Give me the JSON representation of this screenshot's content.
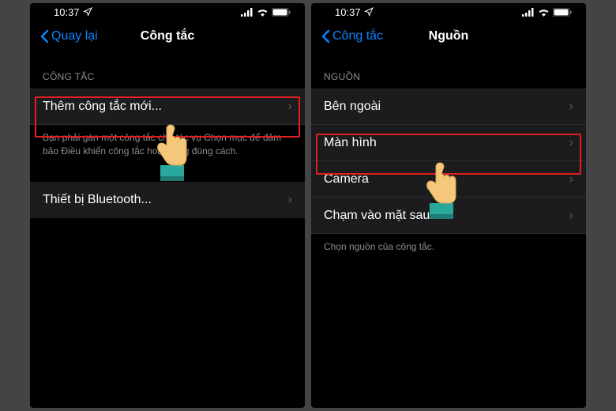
{
  "status": {
    "time": "10:37",
    "nav_icon": "navigation-icon"
  },
  "left": {
    "back_label": "Quay lại",
    "title": "Công tắc",
    "section_header": "CÔNG TẮC",
    "rows": [
      {
        "label": "Thêm công tắc mới..."
      }
    ],
    "footer": "Bạn phải gán một công tắc cho tác vụ Chọn mục để đảm bảo Điều khiển công tắc hoạt động đúng cách.",
    "row2": {
      "label": "Thiết bị Bluetooth..."
    }
  },
  "right": {
    "back_label": "Công tắc",
    "title": "Nguồn",
    "section_header": "NGUỒN",
    "rows": [
      {
        "label": "Bên ngoài"
      },
      {
        "label": "Màn hình"
      },
      {
        "label": "Camera"
      },
      {
        "label": "Chạm vào mặt sau"
      }
    ],
    "footer": "Chọn nguồn của công tắc."
  }
}
